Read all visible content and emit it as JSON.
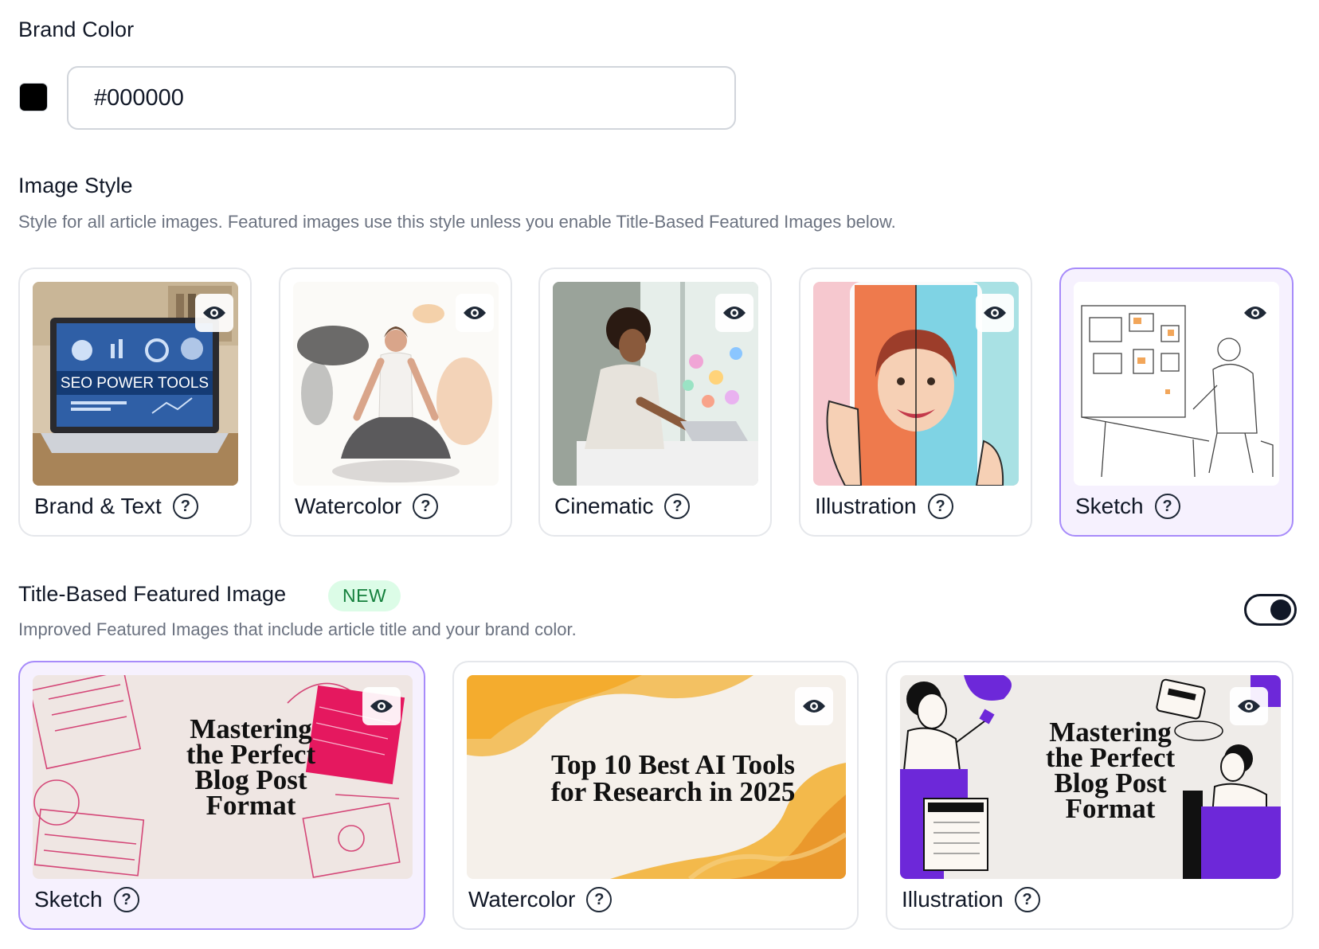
{
  "brand_color": {
    "title": "Brand Color",
    "swatch_color": "#000000",
    "value": "#000000"
  },
  "image_style": {
    "title": "Image Style",
    "description": "Style for all article images. Featured images use this style unless you enable Title-Based Featured Images below.",
    "selected": "Sketch",
    "cards": [
      {
        "label": "Brand & Text",
        "thumb_text": "SEO POWER TOOLS",
        "icon": "eye-icon"
      },
      {
        "label": "Watercolor",
        "icon": "eye-icon"
      },
      {
        "label": "Cinematic",
        "icon": "eye-icon"
      },
      {
        "label": "Illustration",
        "icon": "eye-icon"
      },
      {
        "label": "Sketch",
        "icon": "eye-icon"
      }
    ]
  },
  "title_based": {
    "title": "Title-Based Featured Image",
    "badge": "NEW",
    "description": "Improved Featured Images that include article title and your brand color.",
    "toggle_on": true,
    "selected": "Sketch",
    "cards": [
      {
        "label": "Sketch",
        "thumb_title": [
          "Mastering",
          "the Perfect",
          "Blog Post",
          "Format"
        ]
      },
      {
        "label": "Watercolor",
        "thumb_title": [
          "Top 10 Best AI Tools",
          "for Research in 2025"
        ]
      },
      {
        "label": "Illustration",
        "thumb_title": [
          "Mastering",
          "the Perfect",
          "Blog Post",
          "Format"
        ]
      }
    ]
  },
  "colors": {
    "selected_border": "#a78bfa",
    "selected_bg": "#f6f1fe",
    "badge_bg": "#dcfce7",
    "badge_text": "#15803d",
    "accent_pink": "#e11d63",
    "accent_purple": "#6d28d9"
  }
}
